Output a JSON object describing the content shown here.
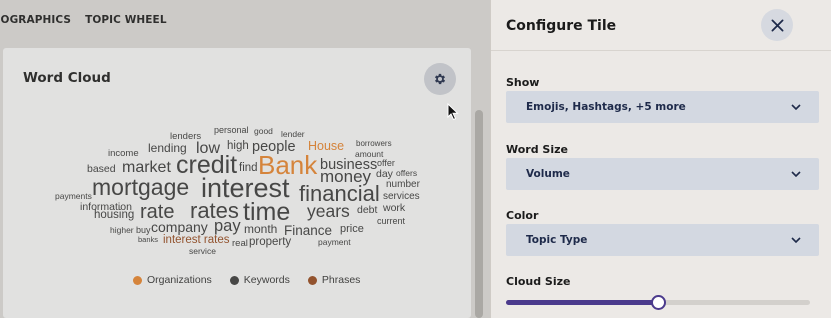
{
  "nav": {
    "tabs": [
      {
        "label": "MOGRAPHICS"
      },
      {
        "label": "TOPIC WHEEL"
      }
    ]
  },
  "card": {
    "title": "Word Cloud",
    "settings_icon": "gear-icon"
  },
  "word_cloud": {
    "words": [
      {
        "text": "lenders",
        "color": "#3a3a3a"
      },
      {
        "text": "personal",
        "color": "#3a3a3a"
      },
      {
        "text": "good",
        "color": "#3a3a3a"
      },
      {
        "text": "lender",
        "color": "#3a3a3a"
      },
      {
        "text": "borrowers",
        "color": "#3a3a3a"
      },
      {
        "text": "lending",
        "color": "#3a3a3a"
      },
      {
        "text": "low",
        "color": "#3a3a3a"
      },
      {
        "text": "high",
        "color": "#3a3a3a"
      },
      {
        "text": "people",
        "color": "#3a3a3a"
      },
      {
        "text": "House",
        "color": "#f0882c"
      },
      {
        "text": "amount",
        "color": "#3a3a3a"
      },
      {
        "text": "income",
        "color": "#3a3a3a"
      },
      {
        "text": "market",
        "color": "#3a3a3a"
      },
      {
        "text": "credit",
        "color": "#3a3a3a"
      },
      {
        "text": "find",
        "color": "#3a3a3a"
      },
      {
        "text": "Bank",
        "color": "#f0882c"
      },
      {
        "text": "business",
        "color": "#3a3a3a"
      },
      {
        "text": "offer",
        "color": "#3a3a3a"
      },
      {
        "text": "based",
        "color": "#3a3a3a"
      },
      {
        "text": "money",
        "color": "#3a3a3a"
      },
      {
        "text": "day",
        "color": "#3a3a3a"
      },
      {
        "text": "offers",
        "color": "#3a3a3a"
      },
      {
        "text": "mortgage",
        "color": "#3a3a3a"
      },
      {
        "text": "interest",
        "color": "#3a3a3a"
      },
      {
        "text": "financial",
        "color": "#3a3a3a"
      },
      {
        "text": "number",
        "color": "#3a3a3a"
      },
      {
        "text": "payments",
        "color": "#3a3a3a"
      },
      {
        "text": "services",
        "color": "#3a3a3a"
      },
      {
        "text": "information",
        "color": "#3a3a3a"
      },
      {
        "text": "rate",
        "color": "#3a3a3a"
      },
      {
        "text": "rates",
        "color": "#3a3a3a"
      },
      {
        "text": "time",
        "color": "#3a3a3a"
      },
      {
        "text": "years",
        "color": "#3a3a3a"
      },
      {
        "text": "debt",
        "color": "#3a3a3a"
      },
      {
        "text": "work",
        "color": "#3a3a3a"
      },
      {
        "text": "housing",
        "color": "#3a3a3a"
      },
      {
        "text": "current",
        "color": "#3a3a3a"
      },
      {
        "text": "higher",
        "color": "#3a3a3a"
      },
      {
        "text": "buy",
        "color": "#3a3a3a"
      },
      {
        "text": "company",
        "color": "#3a3a3a"
      },
      {
        "text": "pay",
        "color": "#3a3a3a"
      },
      {
        "text": "month",
        "color": "#3a3a3a"
      },
      {
        "text": "Finance",
        "color": "#3a3a3a"
      },
      {
        "text": "price",
        "color": "#3a3a3a"
      },
      {
        "text": "banks",
        "color": "#3a3a3a"
      },
      {
        "text": "interest rates",
        "color": "#9b4a1c"
      },
      {
        "text": "real",
        "color": "#3a3a3a"
      },
      {
        "text": "property",
        "color": "#3a3a3a"
      },
      {
        "text": "payment",
        "color": "#3a3a3a"
      },
      {
        "text": "service",
        "color": "#3a3a3a"
      }
    ]
  },
  "legend": [
    {
      "label": "Organizations",
      "color": "#f0882c"
    },
    {
      "label": "Keywords",
      "color": "#3a3a3a"
    },
    {
      "label": "Phrases",
      "color": "#9b4a1c"
    }
  ],
  "panel": {
    "title": "Configure Tile",
    "close_icon": "close-icon",
    "show": {
      "label": "Show",
      "value": "Emojis, Hashtags, +5 more"
    },
    "word_size": {
      "label": "Word Size",
      "value": "Volume"
    },
    "color": {
      "label": "Color",
      "value": "Topic Type"
    },
    "cloud_size": {
      "label": "Cloud Size",
      "value_fraction": 0.5
    },
    "accent_color": "#4b3a8c"
  }
}
